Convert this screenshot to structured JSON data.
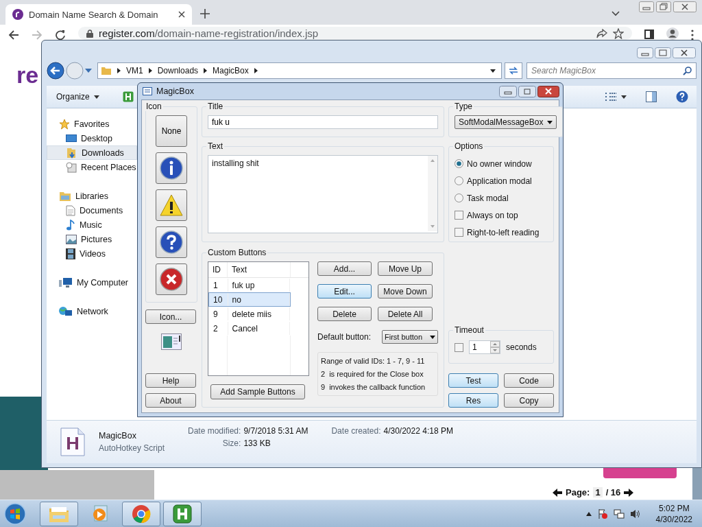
{
  "browser": {
    "tab_title": "Domain Name Search & Domain",
    "url_host": "register.com",
    "url_path": "/domain-name-registration/index.jsp",
    "logo": "re",
    "pager": {
      "label": "Page:",
      "current": "1",
      "total": "/ 16"
    }
  },
  "explorer": {
    "breadcrumb": [
      "VM1",
      "Downloads",
      "MagicBox"
    ],
    "search": {
      "placeholder": "Search MagicBox"
    },
    "organize": "Organize",
    "nav": [
      {
        "label": "Favorites",
        "kind": "star",
        "selected": false,
        "children": [
          {
            "label": "Desktop",
            "kind": "desktop",
            "selected": false
          },
          {
            "label": "Downloads",
            "kind": "downloads",
            "selected": true
          },
          {
            "label": "Recent Places",
            "kind": "recent",
            "selected": false
          }
        ]
      },
      {
        "label": "Libraries",
        "kind": "library",
        "selected": false,
        "children": [
          {
            "label": "Documents",
            "kind": "documents",
            "selected": false
          },
          {
            "label": "Music",
            "kind": "music",
            "selected": false
          },
          {
            "label": "Pictures",
            "kind": "pictures",
            "selected": false
          },
          {
            "label": "Videos",
            "kind": "videos",
            "selected": false
          }
        ]
      },
      {
        "label": "My Computer",
        "kind": "computer",
        "selected": false
      },
      {
        "label": "Network",
        "kind": "network",
        "selected": false
      }
    ],
    "details": {
      "name": "MagicBox",
      "type": "AutoHotkey Script",
      "fields": [
        {
          "label": "Date modified:",
          "value": "9/7/2018 5:31 AM"
        },
        {
          "label": "Size:",
          "value": "133 KB"
        },
        {
          "label": "Date created:",
          "value": "4/30/2022 4:18 PM"
        }
      ]
    }
  },
  "dialog": {
    "title": "MagicBox",
    "icon_group": {
      "label": "Icon",
      "buttons": [
        {
          "kind": "none",
          "label": "None"
        },
        {
          "kind": "info"
        },
        {
          "kind": "warning"
        },
        {
          "kind": "question"
        },
        {
          "kind": "error"
        }
      ],
      "more": "Icon..."
    },
    "help": "Help",
    "about": "About",
    "title_field": {
      "label": "Title",
      "value": "fuk u"
    },
    "text_field": {
      "label": "Text",
      "value": "installing shit"
    },
    "custom_buttons": {
      "label": "Custom Buttons",
      "columns": [
        "ID",
        "Text"
      ],
      "rows": [
        {
          "id": "1",
          "text": "fuk up",
          "selected": false
        },
        {
          "id": "10",
          "text": "no",
          "selected": true
        },
        {
          "id": "9",
          "text": "delete miis",
          "selected": false
        },
        {
          "id": "2",
          "text": "Cancel",
          "selected": false
        }
      ],
      "actions": [
        {
          "label": "Add...",
          "highlighted": false
        },
        {
          "label": "Move Up",
          "highlighted": false
        },
        {
          "label": "Edit...",
          "highlighted": true
        },
        {
          "label": "Move Down",
          "highlighted": false
        },
        {
          "label": "Delete",
          "highlighted": false
        },
        {
          "label": "Delete All",
          "highlighted": false
        }
      ],
      "default_label": "Default button:",
      "default_value": "First button",
      "info": [
        {
          "text": "Range of valid IDs: 1 - 7, 9 - 11"
        },
        {
          "key": "2",
          "text": "is required for the Close box"
        },
        {
          "key": "9",
          "text": "invokes the callback function"
        }
      ],
      "sample": "Add Sample Buttons"
    },
    "type": {
      "label": "Type",
      "value": "SoftModalMessageBox"
    },
    "options": {
      "label": "Options",
      "items": [
        {
          "kind": "radio",
          "label": "No owner window",
          "checked": true
        },
        {
          "kind": "radio",
          "label": "Application modal",
          "checked": false
        },
        {
          "kind": "radio",
          "label": "Task modal",
          "checked": false
        },
        {
          "kind": "checkbox",
          "label": "Always on top",
          "checked": false
        },
        {
          "kind": "checkbox",
          "label": "Right-to-left reading",
          "checked": false
        }
      ]
    },
    "timeout": {
      "label": "Timeout",
      "checked": false,
      "value": "1",
      "unit": "seconds"
    },
    "buttons": [
      {
        "label": "Test",
        "highlighted": true
      },
      {
        "label": "Code",
        "highlighted": false
      },
      {
        "label": "Res",
        "highlighted": true
      },
      {
        "label": "Copy",
        "highlighted": false
      }
    ]
  },
  "taskbar": {
    "apps": [
      {
        "kind": "explorer",
        "open": true
      },
      {
        "kind": "media",
        "open": false
      },
      {
        "kind": "chrome",
        "open": true
      },
      {
        "kind": "ahk",
        "open": true
      }
    ],
    "clock": {
      "time": "5:02 PM",
      "date": "4/30/2022"
    }
  }
}
